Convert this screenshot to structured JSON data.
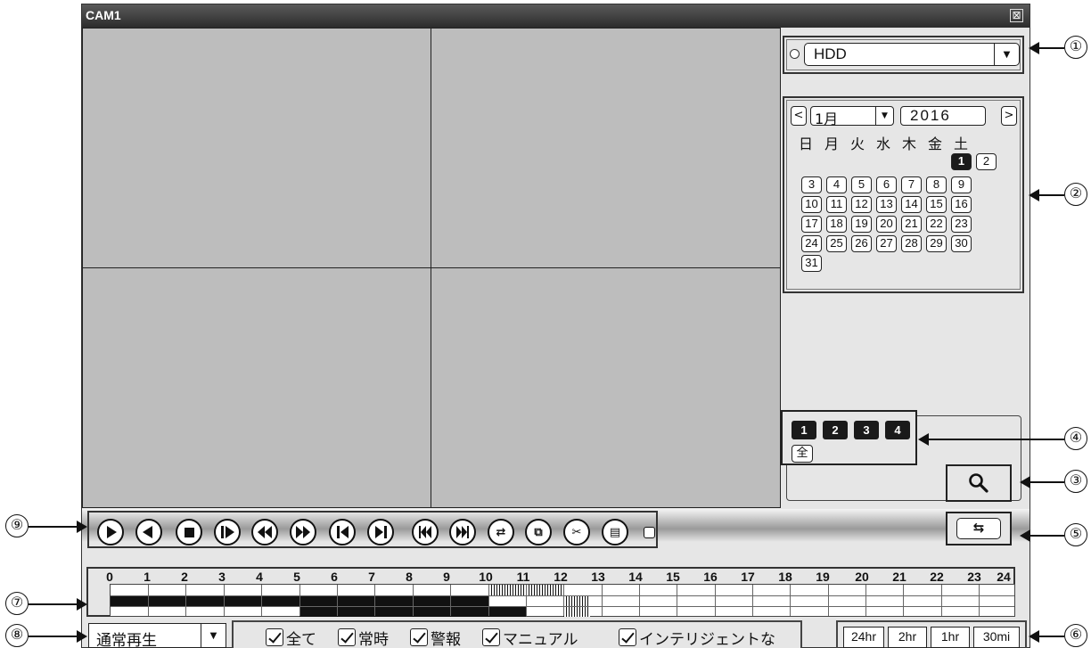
{
  "window": {
    "title": "CAM1",
    "close_glyph": "⊠"
  },
  "source": {
    "selected": "HDD",
    "arrow": "▼"
  },
  "calendar": {
    "month": "1月",
    "year": "2016",
    "prev": "<",
    "next": ">",
    "weekdays": [
      "日",
      "月",
      "火",
      "水",
      "木",
      "金",
      "土"
    ],
    "days": [
      "1",
      "2",
      "3",
      "4",
      "5",
      "6",
      "7",
      "8",
      "9",
      "10",
      "11",
      "12",
      "13",
      "14",
      "15",
      "16",
      "17",
      "18",
      "19",
      "20",
      "21",
      "22",
      "23",
      "24",
      "25",
      "26",
      "27",
      "28",
      "29",
      "30",
      "31"
    ],
    "selected_day": "1"
  },
  "channels": {
    "items": [
      "1",
      "2",
      "3",
      "4"
    ],
    "all_label": "全"
  },
  "playback_controls": [
    "play",
    "reverse-play",
    "stop",
    "next-frame",
    "rewind",
    "fast-forward",
    "previous",
    "next",
    "skip-back",
    "skip-forward",
    "sync",
    "windows",
    "clip",
    "save",
    "stop-small"
  ],
  "timeline": {
    "hours": [
      "0",
      "1",
      "2",
      "3",
      "4",
      "5",
      "6",
      "7",
      "8",
      "9",
      "10",
      "11",
      "12",
      "13",
      "14",
      "15",
      "16",
      "17",
      "18",
      "19",
      "20",
      "21",
      "22",
      "23",
      "24"
    ]
  },
  "playback_mode": {
    "selected": "通常再生",
    "arrow": "▼"
  },
  "filters": [
    "全て",
    "常時",
    "警報",
    "マニュアル",
    "インテリジェントな"
  ],
  "zoom": [
    "24hr",
    "2hr",
    "1hr",
    "30mi"
  ],
  "callouts": [
    "①",
    "②",
    "③",
    "④",
    "⑤",
    "⑥",
    "⑦",
    "⑧",
    "⑨"
  ]
}
